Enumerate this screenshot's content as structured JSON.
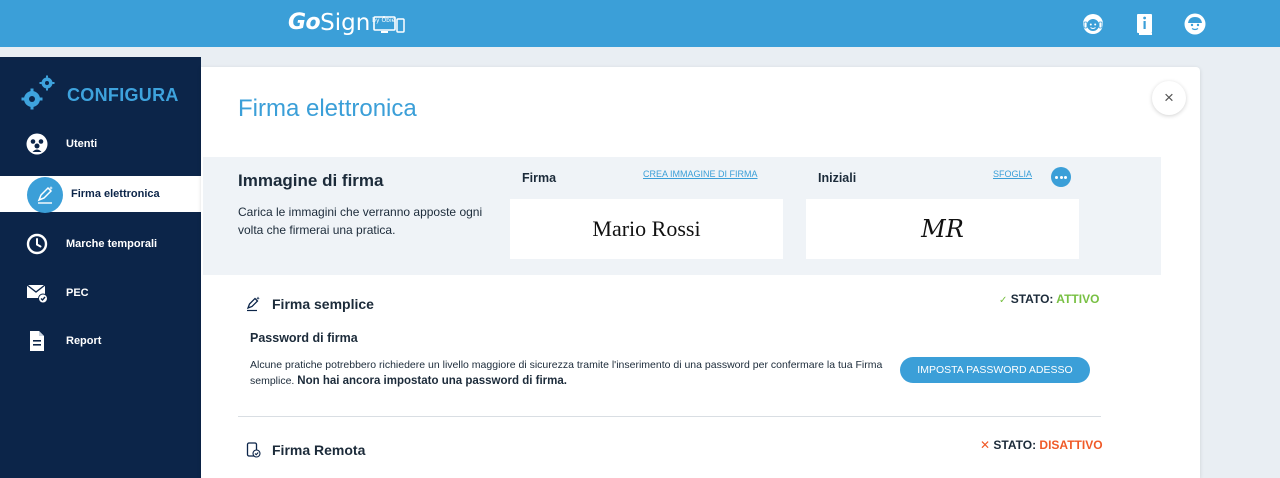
{
  "header": {
    "logo_go": "Go",
    "logo_sign": "Sign",
    "logo_by": "by Öbie",
    "icons": [
      "support-icon",
      "info-icon",
      "user-avatar-icon"
    ]
  },
  "sidebar": {
    "title": "CONFIGURA",
    "items": [
      {
        "label": "Utenti",
        "icon": "users-icon"
      },
      {
        "label": "Firma elettronica",
        "icon": "pen-icon",
        "active": true
      },
      {
        "label": "Marche temporali",
        "icon": "clock-icon"
      },
      {
        "label": "PEC",
        "icon": "mail-check-icon"
      },
      {
        "label": "Report",
        "icon": "document-icon"
      }
    ]
  },
  "main": {
    "title": "Firma elettronica",
    "close": "×",
    "signature_image": {
      "heading": "Immagine di firma",
      "description": "Carica le immagini che verranno apposte ogni volta che firmerai una pratica.",
      "firma_label": "Firma",
      "crea_link": "CREA IMMAGINE DI FIRMA",
      "firma_value": "Mario Rossi",
      "iniziali_label": "Iniziali",
      "sfoglia_link": "SFOGLIA",
      "iniziali_value": "MR"
    },
    "firma_semplice": {
      "title": "Firma semplice",
      "status_label": "STATO:",
      "status_value": "ATTIVO",
      "password_title": "Password di firma",
      "password_desc": "Alcune pratiche potrebbero richiedere un livello maggiore di sicurezza tramite l'inserimento di una password per confermare la tua Firma semplice.",
      "password_warning": "Non hai ancora impostato una password di firma.",
      "button": "IMPOSTA PASSWORD ADESSO"
    },
    "firma_remota": {
      "title": "Firma Remota",
      "status_label": "STATO:",
      "status_value": "DISATTIVO"
    }
  },
  "colors": {
    "topbar": "#3b9fd8",
    "sidebar": "#0c2549",
    "active": "#78c043",
    "inactive": "#f05a28"
  }
}
